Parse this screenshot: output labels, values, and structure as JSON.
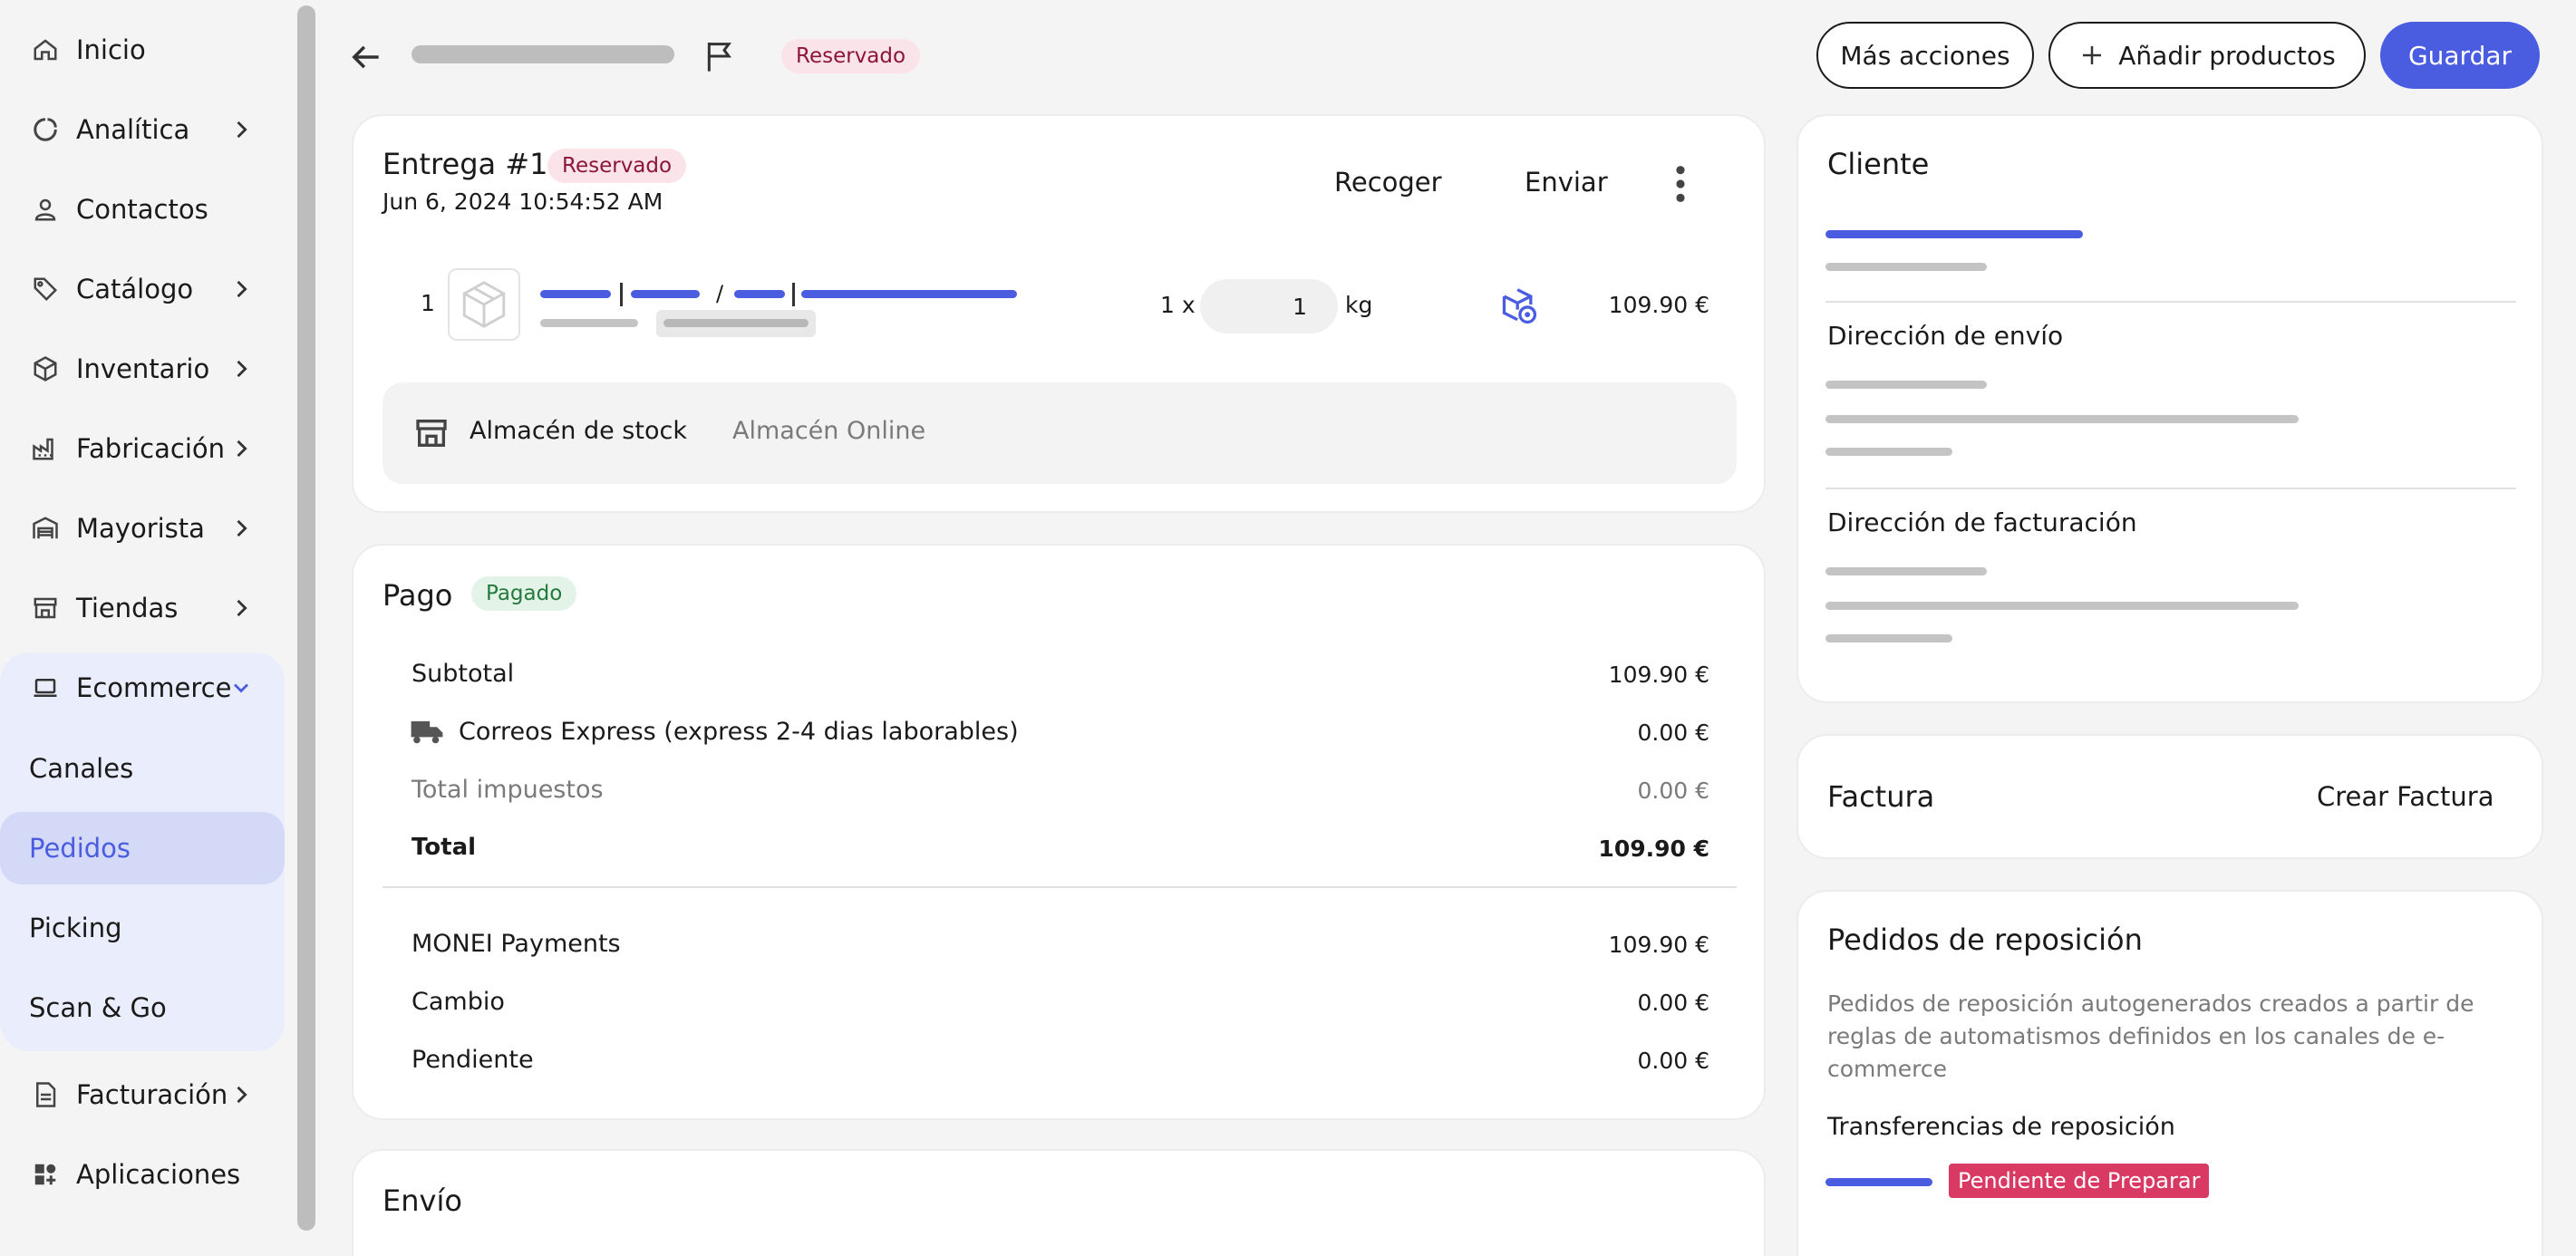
{
  "sidebar": {
    "items": [
      {
        "label": "Inicio",
        "icon": "home-icon"
      },
      {
        "label": "Analítica",
        "icon": "analytics-icon"
      },
      {
        "label": "Contactos",
        "icon": "user-icon"
      },
      {
        "label": "Catálogo",
        "icon": "tag-icon"
      },
      {
        "label": "Inventario",
        "icon": "box-icon"
      },
      {
        "label": "Fabricación",
        "icon": "factory-icon"
      },
      {
        "label": "Mayorista",
        "icon": "warehouse-icon"
      },
      {
        "label": "Tiendas",
        "icon": "store-icon"
      },
      {
        "label": "Ecommerce",
        "icon": "laptop-icon"
      },
      {
        "label": "Facturación",
        "icon": "document-icon"
      },
      {
        "label": "Aplicaciones",
        "icon": "apps-icon"
      }
    ],
    "ecommerce_sub": [
      {
        "label": "Canales"
      },
      {
        "label": "Pedidos"
      },
      {
        "label": "Picking"
      },
      {
        "label": "Scan & Go"
      }
    ]
  },
  "header": {
    "status_badge": "Reservado",
    "more_actions": "Más acciones",
    "add_products": "Añadir productos",
    "save": "Guardar"
  },
  "delivery": {
    "title": "Entrega #1",
    "badge": "Reservado",
    "date": "Jun 6, 2024 10:54:52 AM",
    "pickup": "Recoger",
    "ship": "Enviar",
    "line": {
      "index": "1",
      "qty_prefix": "1 x",
      "qty_value": "1",
      "unit": "kg",
      "price": "109.90 €"
    },
    "warehouse_label": "Almacén de stock",
    "warehouse_value": "Almacén Online"
  },
  "payment": {
    "title": "Pago",
    "badge": "Pagado",
    "subtotal_label": "Subtotal",
    "subtotal_value": "109.90 €",
    "shipping_label": "Correos Express (express 2-4 dias laborables)",
    "shipping_value": "0.00 €",
    "taxes_label": "Total impuestos",
    "taxes_value": "0.00 €",
    "total_label": "Total",
    "total_value": "109.90 €",
    "method_label": "MONEI Payments",
    "method_value": "109.90 €",
    "change_label": "Cambio",
    "change_value": "0.00 €",
    "pending_label": "Pendiente",
    "pending_value": "0.00 €"
  },
  "shipping_card": {
    "title": "Envío"
  },
  "customer": {
    "title": "Cliente",
    "shipping_address": "Dirección de envío",
    "billing_address": "Dirección de facturación"
  },
  "invoice": {
    "title": "Factura",
    "create": "Crear Factura"
  },
  "replenishment": {
    "title": "Pedidos de reposición",
    "description": "Pedidos de reposición autogenerados creados a partir de reglas de automatismos definidos en los canales de e-commerce",
    "transfers_title": "Transferencias de reposición",
    "transfer_status": "Pendiente de Preparar"
  },
  "colors": {
    "accent": "#4a5de0",
    "pending_red": "#d93a64"
  }
}
